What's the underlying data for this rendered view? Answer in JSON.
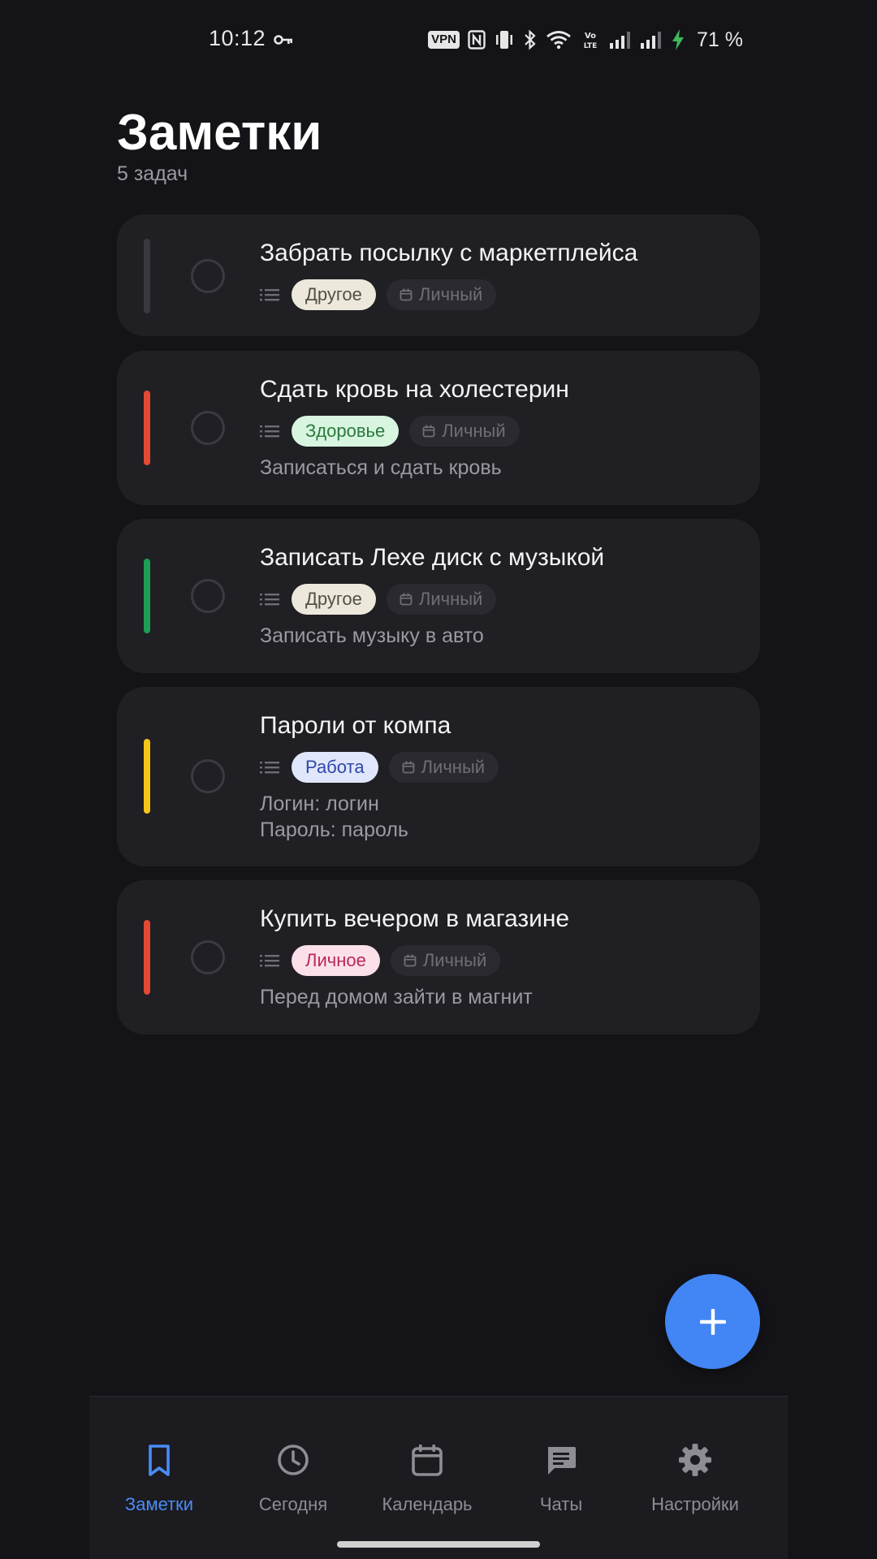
{
  "status_bar": {
    "time": "10:12",
    "vpn": "VPN",
    "battery_percent": "71 %",
    "icons": [
      "key-icon",
      "nfc-icon",
      "vibrate-icon",
      "bluetooth-icon",
      "wifi-icon",
      "volte-icon",
      "signal-icon",
      "signal-icon",
      "battery-charging-icon"
    ],
    "volte": "VoLTE"
  },
  "header": {
    "title": "Заметки",
    "count": "5 задач"
  },
  "tasks": [
    {
      "title": "Забрать посылку с маркетплейса",
      "tag": "Другое",
      "tag_bg": "#ece8dc",
      "tag_color": "#555045",
      "list": "Личный",
      "description": "",
      "priority_color": "#38383e"
    },
    {
      "title": "Сдать кровь на холестерин",
      "tag": "Здоровье",
      "tag_bg": "#d8f5df",
      "tag_color": "#2b7a3e",
      "list": "Личный",
      "description": "Записаться и сдать кровь",
      "priority_color": "#e34a33"
    },
    {
      "title": "Записать Лехе диск с музыкой",
      "tag": "Другое",
      "tag_bg": "#ece8dc",
      "tag_color": "#555045",
      "list": "Личный",
      "description": "Записать музыку в авто",
      "priority_color": "#1e9e55"
    },
    {
      "title": "Пароли от компа",
      "tag": "Работа",
      "tag_bg": "#e0e6fb",
      "tag_color": "#2f48a8",
      "list": "Личный",
      "description_lines": [
        "Логин: логин",
        "Пароль: пароль"
      ],
      "priority_color": "#f5c518"
    },
    {
      "title": "Купить вечером в магазине",
      "tag": "Личное",
      "tag_bg": "#fbe0ea",
      "tag_color": "#b8285a",
      "list": "Личный",
      "description": "Перед домом зайти в магнит",
      "priority_color": "#e34a33"
    }
  ],
  "fab": {
    "icon": "plus-icon"
  },
  "nav": {
    "items": [
      {
        "label": "Заметки",
        "icon": "bookmark-icon",
        "active": true
      },
      {
        "label": "Сегодня",
        "icon": "clock-icon",
        "active": false
      },
      {
        "label": "Календарь",
        "icon": "calendar-icon",
        "active": false
      },
      {
        "label": "Чаты",
        "icon": "chat-icon",
        "active": false
      },
      {
        "label": "Настройки",
        "icon": "gear-icon",
        "active": false
      }
    ]
  },
  "colors": {
    "background": "#141418",
    "card": "#1f1f24",
    "accent": "#4a8cf7",
    "fab": "#4285f4"
  }
}
